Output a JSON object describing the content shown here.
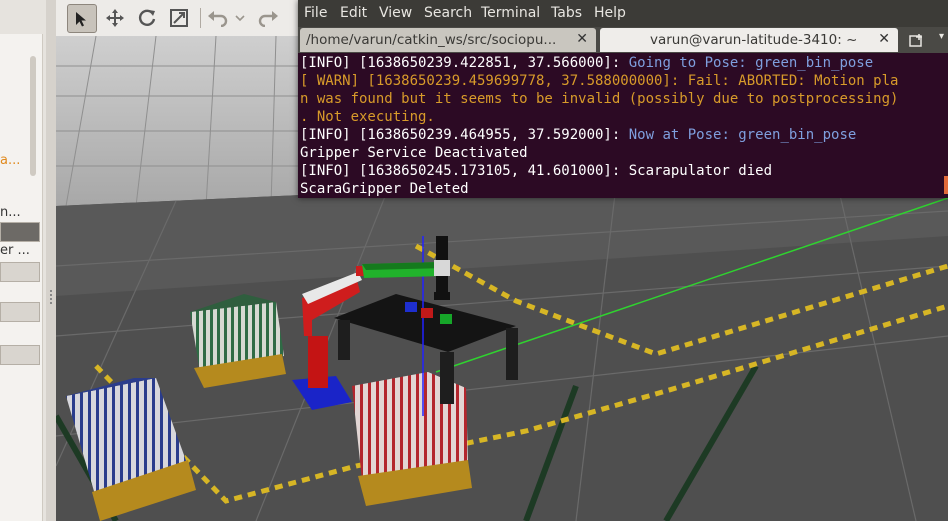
{
  "left_panel": {
    "fragments": [
      "a...",
      "n...",
      "er ..."
    ]
  },
  "toolbar": {
    "tools": [
      {
        "name": "select-arrow-icon",
        "active": true
      },
      {
        "name": "translate-icon",
        "active": false
      },
      {
        "name": "rotate-icon",
        "active": false
      },
      {
        "name": "scale-icon",
        "active": false
      },
      {
        "name": "undo-icon",
        "active": false
      },
      {
        "name": "redo-icon",
        "active": false
      }
    ]
  },
  "terminal": {
    "menu": [
      "File",
      "Edit",
      "View",
      "Search",
      "Terminal",
      "Tabs",
      "Help"
    ],
    "tabs": [
      {
        "label": "/home/varun/catkin_ws/src/sociopu...",
        "active": false
      },
      {
        "label": "varun@varun-latitude-3410: ~",
        "active": true
      }
    ],
    "lines": [
      {
        "prefix": "[INFO] [1638650239.422851, 37.566000]: ",
        "message": "Going to Pose: green_bin_pose",
        "type": "info"
      },
      {
        "text": "[ WARN] [1638650239.459699778, 37.588000000]: Fail: ABORTED: Motion pla",
        "type": "warn"
      },
      {
        "text": "n was found but it seems to be invalid (possibly due to postprocessing)",
        "type": "warn"
      },
      {
        "text": ". Not executing.",
        "type": "warn"
      },
      {
        "prefix": "[INFO] [1638650239.464955, 37.592000]: ",
        "message": "Now at Pose: green_bin_pose",
        "type": "info"
      },
      {
        "text": "Gripper Service Deactivated",
        "type": "plain"
      },
      {
        "text": "[INFO] [1638650245.173105, 41.601000]: Scarapulator died",
        "type": "plain"
      },
      {
        "text": "ScaraGripper Deleted",
        "type": "plain"
      }
    ],
    "colors": {
      "background": "#2c0a24",
      "warn": "#d89b2a",
      "info_message": "#7f9fde",
      "text": "#ffffff"
    }
  }
}
